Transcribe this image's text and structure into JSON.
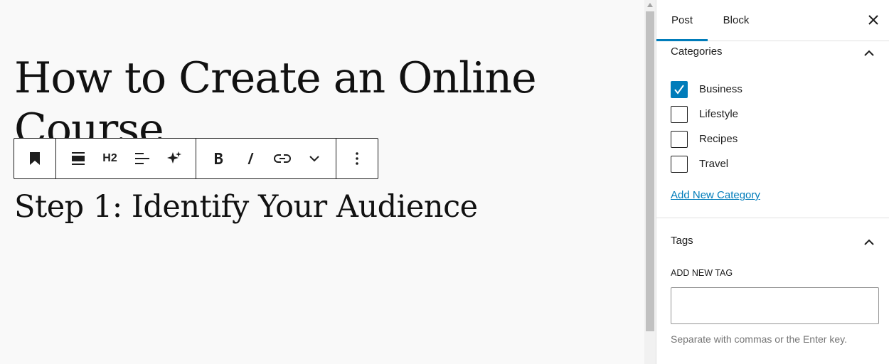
{
  "editor": {
    "post_title": "How to Create an Online Course",
    "heading_block": "Step 1: Identify Your Audience"
  },
  "toolbar": {
    "buttons": [
      {
        "name": "bookmark-icon"
      },
      {
        "name": "align-icon"
      },
      {
        "name": "heading-level",
        "label": "H2"
      },
      {
        "name": "text-align-icon"
      },
      {
        "name": "sparkle-icon"
      },
      {
        "name": "bold-icon"
      },
      {
        "name": "italic-icon"
      },
      {
        "name": "link-icon"
      },
      {
        "name": "chevron-down-icon"
      },
      {
        "name": "more-options-icon"
      }
    ]
  },
  "sidebar": {
    "tabs": [
      {
        "label": "Post",
        "active": true
      },
      {
        "label": "Block",
        "active": false
      }
    ],
    "categories": {
      "title": "Categories",
      "items": [
        {
          "label": "Business",
          "checked": true
        },
        {
          "label": "Lifestyle",
          "checked": false
        },
        {
          "label": "Recipes",
          "checked": false
        },
        {
          "label": "Travel",
          "checked": false
        }
      ],
      "add_new_label": "Add New Category"
    },
    "tags": {
      "title": "Tags",
      "add_new_label": "ADD NEW TAG",
      "input_value": "",
      "help_text": "Separate with commas or the Enter key."
    }
  },
  "colors": {
    "accent": "#007cba",
    "text": "#1e1e1e",
    "canvas_bg": "#f9f9f9",
    "help_text": "#757575"
  }
}
